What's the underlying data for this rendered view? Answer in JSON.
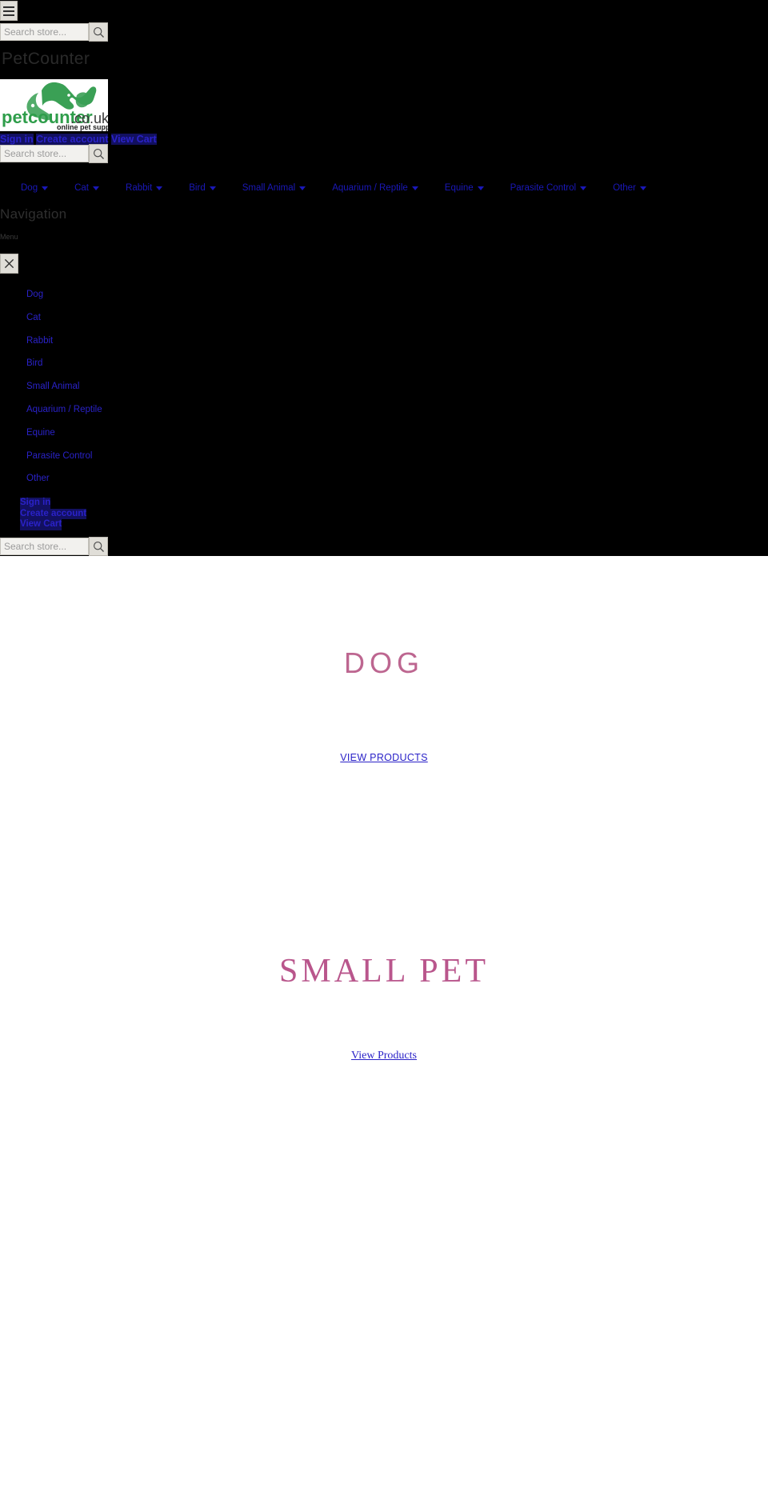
{
  "site": {
    "wordmark_faded": "PetCounter",
    "logo": {
      "brand": "petcounter",
      "tld": ".co.uk",
      "tagline": "online pet supplies",
      "brand_color": "#2e9d4a",
      "tld_color": "#3a3a3a"
    }
  },
  "search": {
    "placeholder": "Search store...",
    "value": "",
    "icon": "search-icon",
    "button_label": "Search"
  },
  "header": {
    "menu_icon": "hamburger-icon",
    "account_links": [
      {
        "label": "Sign in"
      },
      {
        "label": "Create account"
      },
      {
        "label": "View Cart"
      }
    ]
  },
  "topnav": {
    "items": [
      {
        "label": "Dog",
        "has_dropdown": true
      },
      {
        "label": "Cat",
        "has_dropdown": true
      },
      {
        "label": "Rabbit",
        "has_dropdown": true
      },
      {
        "label": "Bird",
        "has_dropdown": true
      },
      {
        "label": "Small Animal",
        "has_dropdown": true
      },
      {
        "label": "Aquarium / Reptile",
        "has_dropdown": true
      },
      {
        "label": "Equine",
        "has_dropdown": true
      },
      {
        "label": "Parasite Control",
        "has_dropdown": true
      },
      {
        "label": "Other",
        "has_dropdown": true
      }
    ]
  },
  "drawer": {
    "heading": "Navigation",
    "subheading": "Menu",
    "close_icon": "close-icon",
    "items": [
      {
        "label": "Dog"
      },
      {
        "label": "Cat"
      },
      {
        "label": "Rabbit"
      },
      {
        "label": "Bird"
      },
      {
        "label": "Small Animal"
      },
      {
        "label": "Aquarium / Reptile"
      },
      {
        "label": "Equine"
      },
      {
        "label": "Parasite Control"
      },
      {
        "label": "Other"
      }
    ],
    "account_links": [
      {
        "label": "Sign in"
      },
      {
        "label": "Create account"
      },
      {
        "label": "View Cart"
      }
    ]
  },
  "promos": [
    {
      "title": "DOG",
      "link_label": "VIEW PRODUCTS",
      "title_color": "#bd6690"
    },
    {
      "title": "SMALL PET",
      "link_label": "View Products",
      "title_color": "#b9568c"
    }
  ]
}
